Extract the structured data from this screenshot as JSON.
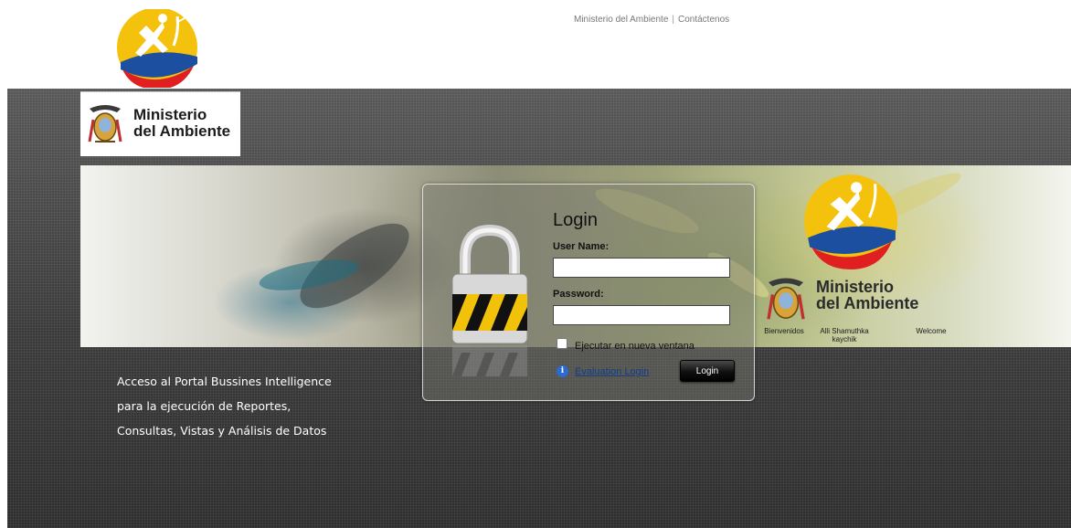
{
  "header": {
    "links": [
      {
        "label": "Ministerio del Ambiente"
      },
      {
        "label": "Contáctenos"
      }
    ],
    "separator": "|"
  },
  "brand": {
    "name_line1": "Ministerio",
    "name_line2": "del Ambiente"
  },
  "login": {
    "title": "Login",
    "username_label": "User Name:",
    "username_value": "",
    "password_label": "Password:",
    "password_value": "",
    "new_window_label": "Ejecutar en nueva ventana",
    "new_window_checked": false,
    "evaluation_link": "Evaluation Login",
    "login_button": "Login"
  },
  "banner": {
    "greetings": [
      {
        "text": "Bienvenidos"
      },
      {
        "text": "Alli Shamuthka kaychik"
      },
      {
        "text": "Welcome"
      }
    ]
  },
  "description": {
    "lines": [
      "Acceso al Portal Bussines Intelligence",
      "para la ejecución de Reportes,",
      "Consultas, Vistas y Análisis de Datos"
    ]
  },
  "colors": {
    "logo_yellow": "#f4c20d",
    "logo_blue": "#1d4fa0",
    "logo_red": "#e02020",
    "band_dark": "#3a3a3a",
    "link_blue": "#133c88"
  },
  "icons": [
    "ecuador-logo-icon",
    "coat-of-arms-icon",
    "padlock-icon",
    "info-icon"
  ]
}
